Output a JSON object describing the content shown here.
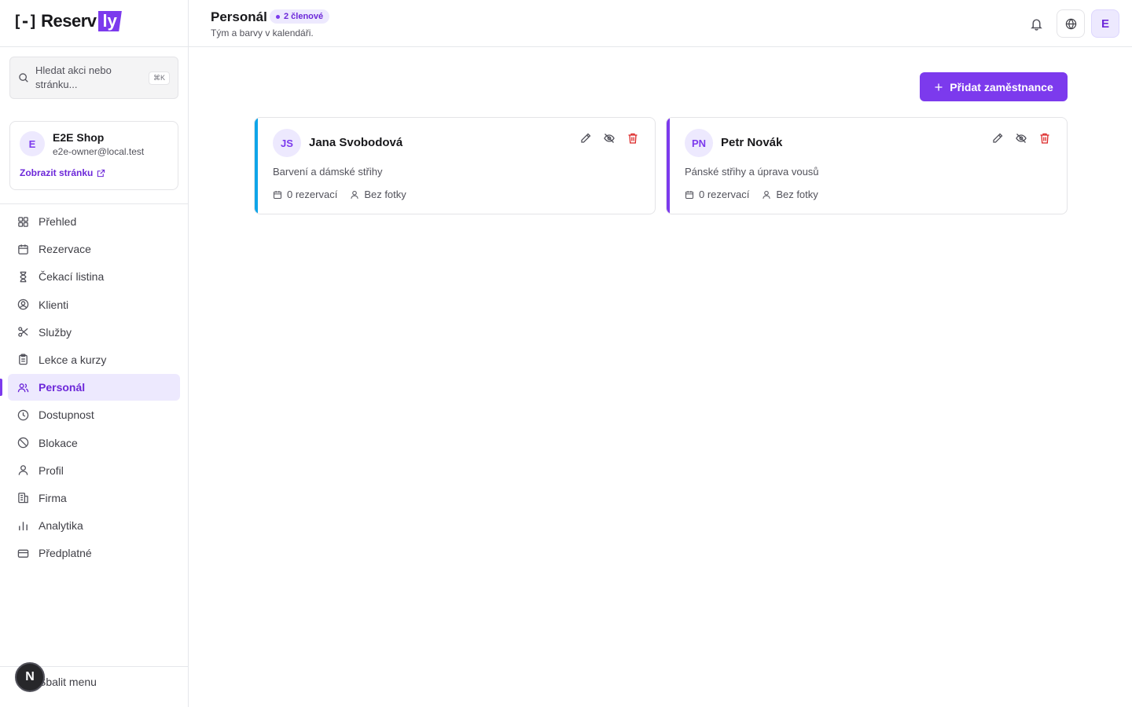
{
  "brand": {
    "name": "Reserv",
    "suffix": "ly",
    "accent": "#7c3aed"
  },
  "search": {
    "placeholder": "Hledat akci nebo stránku...",
    "shortcut": "⌘K"
  },
  "shop": {
    "initial": "E",
    "name": "E2E Shop",
    "email": "e2e-owner@local.test",
    "link_label": "Zobrazit stránku"
  },
  "nav": {
    "items": [
      {
        "label": "Přehled",
        "icon": "grid-icon"
      },
      {
        "label": "Rezervace",
        "icon": "calendar-icon"
      },
      {
        "label": "Čekací listina",
        "icon": "hourglass-icon"
      },
      {
        "label": "Klienti",
        "icon": "user-circle-icon"
      },
      {
        "label": "Služby",
        "icon": "scissors-icon"
      },
      {
        "label": "Lekce a kurzy",
        "icon": "clipboard-icon"
      },
      {
        "label": "Personál",
        "icon": "users-icon",
        "active": true
      },
      {
        "label": "Dostupnost",
        "icon": "clock-icon"
      },
      {
        "label": "Blokace",
        "icon": "ban-icon"
      },
      {
        "label": "Profil",
        "icon": "user-icon"
      },
      {
        "label": "Firma",
        "icon": "building-icon"
      },
      {
        "label": "Analytika",
        "icon": "bar-chart-icon"
      },
      {
        "label": "Předplatné",
        "icon": "credit-card-icon"
      }
    ],
    "collapse_label": "Sbalit menu",
    "dev_badge": "N"
  },
  "header": {
    "title": "Personál",
    "badge": "2 členové",
    "subtitle": "Tým a barvy v kalendáři.",
    "avatar_initial": "E"
  },
  "main": {
    "add_button_label": "Přidat zaměstnance",
    "staff": [
      {
        "initials": "JS",
        "name": "Jana Svobodová",
        "description": "Barvení a dámské střihy",
        "bookings": "0 rezervací",
        "photo_status": "Bez fotky",
        "color": "#0ea5e9"
      },
      {
        "initials": "PN",
        "name": "Petr Novák",
        "description": "Pánské střihy a úprava vousů",
        "bookings": "0 rezervací",
        "photo_status": "Bez fotky",
        "color": "#7c3aed"
      }
    ]
  }
}
